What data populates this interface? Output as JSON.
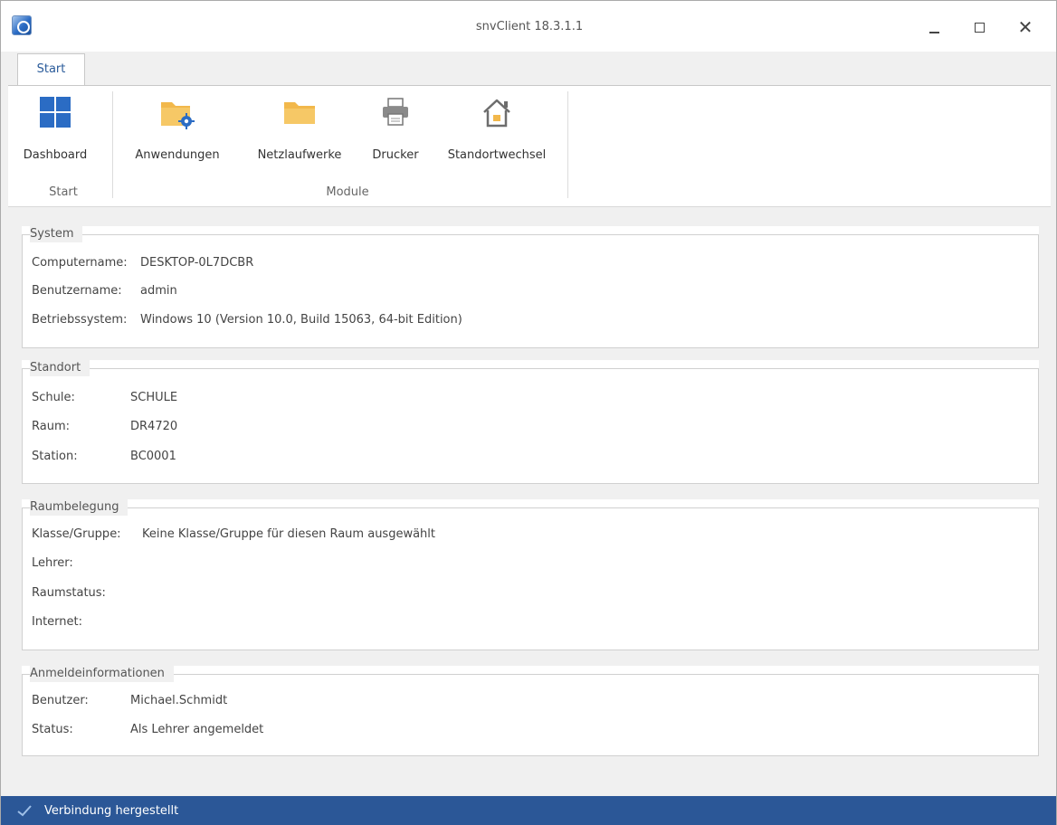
{
  "window": {
    "title": "snvClient 18.3.1.1"
  },
  "ribbon": {
    "tab": "Start",
    "groups": [
      {
        "label": "Start"
      },
      {
        "label": "Module"
      }
    ],
    "items": [
      {
        "label": "Dashboard",
        "icon": "dashboard-grid-icon"
      },
      {
        "label": "Anwendungen",
        "icon": "folder-gear-icon"
      },
      {
        "label": "Netzlaufwerke",
        "icon": "folder-icon"
      },
      {
        "label": "Drucker",
        "icon": "printer-icon"
      },
      {
        "label": "Standortwechsel",
        "icon": "house-icon"
      }
    ]
  },
  "system": {
    "title": "System",
    "rows": [
      {
        "label": "Computername:",
        "value": "DESKTOP-0L7DCBR"
      },
      {
        "label": "Benutzername:",
        "value": "admin"
      },
      {
        "label": "Betriebssystem:",
        "value": "Windows 10 (Version 10.0, Build 15063, 64-bit Edition)"
      }
    ]
  },
  "standort": {
    "title": "Standort",
    "rows": [
      {
        "label": "Schule:",
        "value": "SCHULE"
      },
      {
        "label": "Raum:",
        "value": "DR4720"
      },
      {
        "label": "Station:",
        "value": "BC0001"
      }
    ]
  },
  "raumbelegung": {
    "title": "Raumbelegung",
    "rows": [
      {
        "label": "Klasse/Gruppe:",
        "value": "Keine Klasse/Gruppe für diesen Raum ausgewählt"
      },
      {
        "label": "Lehrer:",
        "value": ""
      },
      {
        "label": "Raumstatus:",
        "value": ""
      },
      {
        "label": "Internet:",
        "value": ""
      }
    ]
  },
  "anmeldung": {
    "title": "Anmeldeinformationen",
    "rows": [
      {
        "label": "Benutzer:",
        "value": "Michael.Schmidt"
      },
      {
        "label": "Status:",
        "value": "Als Lehrer angemeldet"
      }
    ]
  },
  "statusbar": {
    "text": "Verbindung hergestellt",
    "icon": "checkmark-icon"
  },
  "colors": {
    "accent": "#2b5797",
    "folder": "#f2b84b",
    "tile": "#2b6cc4"
  }
}
